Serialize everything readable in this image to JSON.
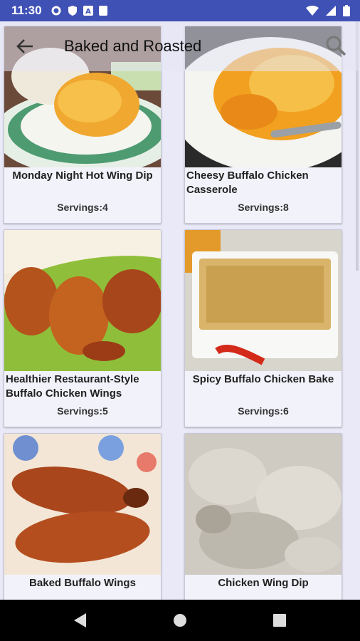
{
  "status": {
    "time": "11:30",
    "icons": [
      "gear-icon",
      "shield-icon",
      "text-icon",
      "sd-card-icon",
      "wifi-icon",
      "signal-icon",
      "battery-icon"
    ]
  },
  "toolbar": {
    "title": "Baked and Roasted",
    "back_icon": "back-arrow-icon",
    "search_icon": "search-icon"
  },
  "recipes": [
    {
      "name": "Monday Night Hot Wing Dip",
      "servings": "Servings:4"
    },
    {
      "name": "Cheesy Buffalo Chicken Casserole",
      "servings": "Servings:8"
    },
    {
      "name": "Healthier Restaurant-Style Buffalo Chicken Wings",
      "servings": "Servings:5"
    },
    {
      "name": "Spicy Buffalo Chicken Bake",
      "servings": "Servings:6"
    },
    {
      "name": "Baked Buffalo Wings",
      "servings": ""
    },
    {
      "name": "Chicken Wing Dip",
      "servings": ""
    }
  ],
  "navbar": {
    "icons": [
      "back-icon",
      "home-icon",
      "recents-icon"
    ]
  }
}
